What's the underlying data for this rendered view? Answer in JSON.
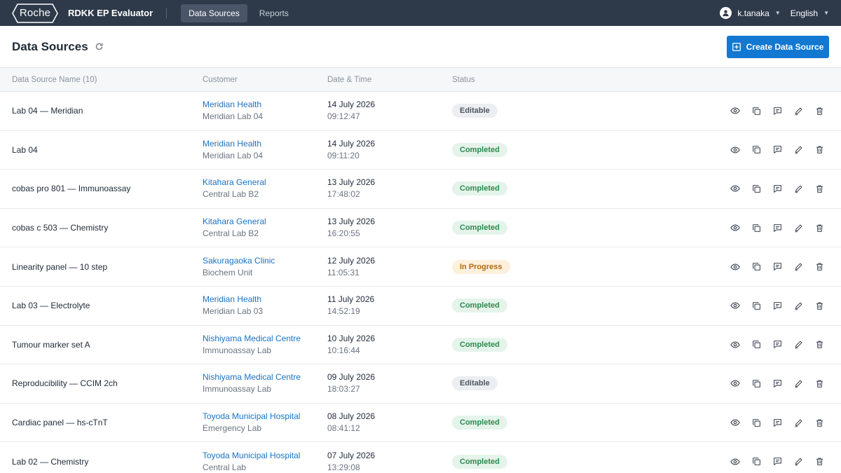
{
  "app": {
    "logo_text": "Roche",
    "title": "RDKK EP Evaluator",
    "nav": [
      {
        "label": "Data Sources",
        "active": true
      },
      {
        "label": "Reports",
        "active": false
      }
    ],
    "user": "k.tanaka",
    "language": "English"
  },
  "page": {
    "title": "Data Sources",
    "create_label": "Create Data Source",
    "accent": "#1278d1"
  },
  "table": {
    "headers": {
      "name": "Data Source Name (10)",
      "customer": "Customer",
      "datetime": "Date & Time",
      "status": "Status"
    },
    "rows": [
      {
        "name": "Lab 04 — Meridian",
        "customer": "Meridian Health",
        "site": "Meridian Lab 04",
        "date": "14 July 2026",
        "time": "09:12:47",
        "status": "Editable",
        "status_type": "editable"
      },
      {
        "name": "Lab 04",
        "customer": "Meridian Health",
        "site": "Meridian Lab 04",
        "date": "14 July 2026",
        "time": "09:11:20",
        "status": "Completed",
        "status_type": "completed"
      },
      {
        "name": "cobas pro 801 — Immunoassay",
        "customer": "Kitahara General",
        "site": "Central Lab B2",
        "date": "13 July 2026",
        "time": "17:48:02",
        "status": "Completed",
        "status_type": "completed"
      },
      {
        "name": "cobas c 503 — Chemistry",
        "customer": "Kitahara General",
        "site": "Central Lab B2",
        "date": "13 July 2026",
        "time": "16:20:55",
        "status": "Completed",
        "status_type": "completed"
      },
      {
        "name": "Linearity panel — 10 step",
        "customer": "Sakuragaoka Clinic",
        "site": "Biochem Unit",
        "date": "12 July 2026",
        "time": "11:05:31",
        "status": "In Progress",
        "status_type": "progress"
      },
      {
        "name": "Lab 03 — Electrolyte",
        "customer": "Meridian Health",
        "site": "Meridian Lab 03",
        "date": "11 July 2026",
        "time": "14:52:19",
        "status": "Completed",
        "status_type": "completed"
      },
      {
        "name": "Tumour marker set A",
        "customer": "Nishiyama Medical Centre",
        "site": "Immunoassay Lab",
        "date": "10 July 2026",
        "time": "10:16:44",
        "status": "Completed",
        "status_type": "completed"
      },
      {
        "name": "Reproducibility — CCIM 2ch",
        "customer": "Nishiyama Medical Centre",
        "site": "Immunoassay Lab",
        "date": "09 July 2026",
        "time": "18:03:27",
        "status": "Editable",
        "status_type": "editable"
      },
      {
        "name": "Cardiac panel — hs-cTnT",
        "customer": "Toyoda Municipal Hospital",
        "site": "Emergency Lab",
        "date": "08 July 2026",
        "time": "08:41:12",
        "status": "Completed",
        "status_type": "completed"
      },
      {
        "name": "Lab 02 — Chemistry",
        "customer": "Toyoda Municipal Hospital",
        "site": "Central Lab",
        "date": "07 July 2026",
        "time": "13:29:08",
        "status": "Completed",
        "status_type": "completed"
      }
    ],
    "row_actions": [
      "eye-icon",
      "copy-icon",
      "comment-icon",
      "pencil-icon",
      "trash-icon"
    ]
  }
}
